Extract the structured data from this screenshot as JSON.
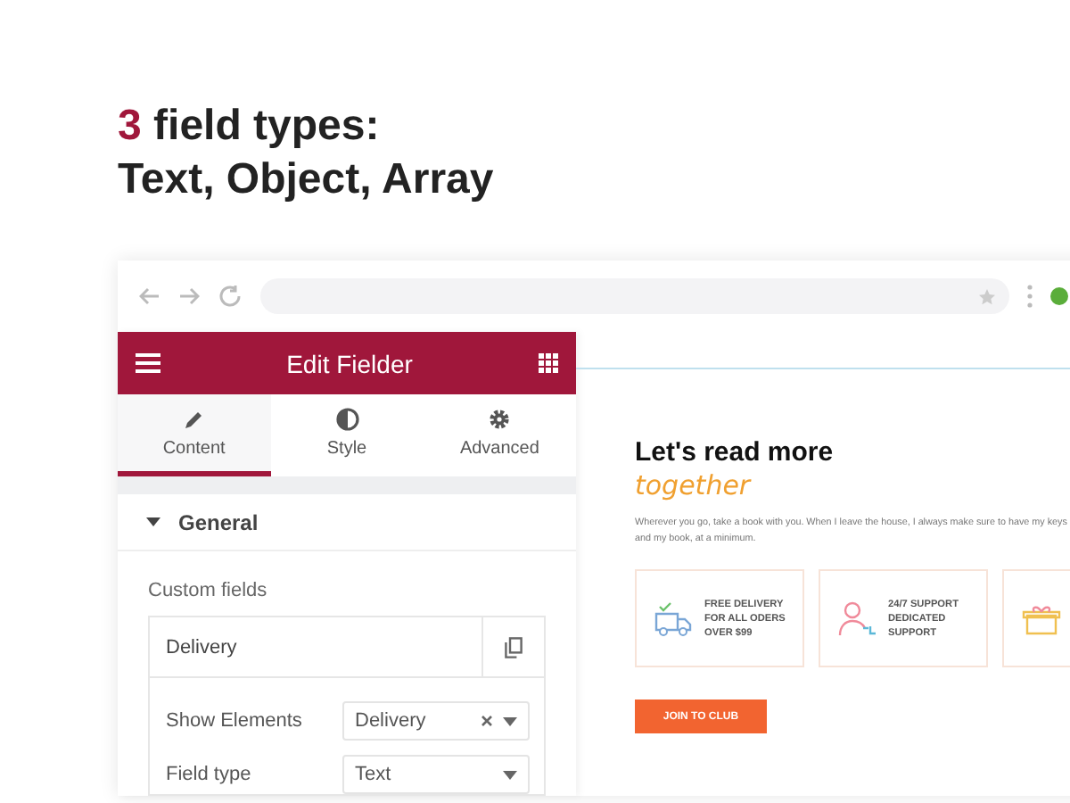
{
  "headline": {
    "number": "3",
    "line1": "field types:",
    "line2": "Text, Object, Array"
  },
  "panel": {
    "title": "Edit Fielder",
    "tabs": [
      {
        "label": "Content",
        "selected": true
      },
      {
        "label": "Style",
        "selected": false
      },
      {
        "label": "Advanced",
        "selected": false
      }
    ],
    "section": {
      "title": "General",
      "expanded": true
    },
    "custom_fields_label": "Custom fields",
    "repeater": {
      "title": "Delivery",
      "rows": [
        {
          "label": "Show Elements",
          "value": "Delivery",
          "clearable": true
        },
        {
          "label": "Field type",
          "value": "Text",
          "clearable": false
        }
      ]
    }
  },
  "preview": {
    "heading": "Let's read more",
    "accent": "together",
    "text": "Wherever you go, take a book with you. When I leave the house, I always make sure to have my keys and my book, at a minimum.",
    "features": [
      {
        "kind": "text",
        "lines": [
          "FREE DELIVERY",
          "FOR ALL ODERS",
          "OVER $99"
        ]
      },
      {
        "kind": "text",
        "lines": [
          "24/7 SUPPORT",
          "DEDICATED",
          "SUPPORT"
        ]
      },
      {
        "kind": "cut"
      }
    ],
    "button": "JOIN TO CLUB"
  }
}
